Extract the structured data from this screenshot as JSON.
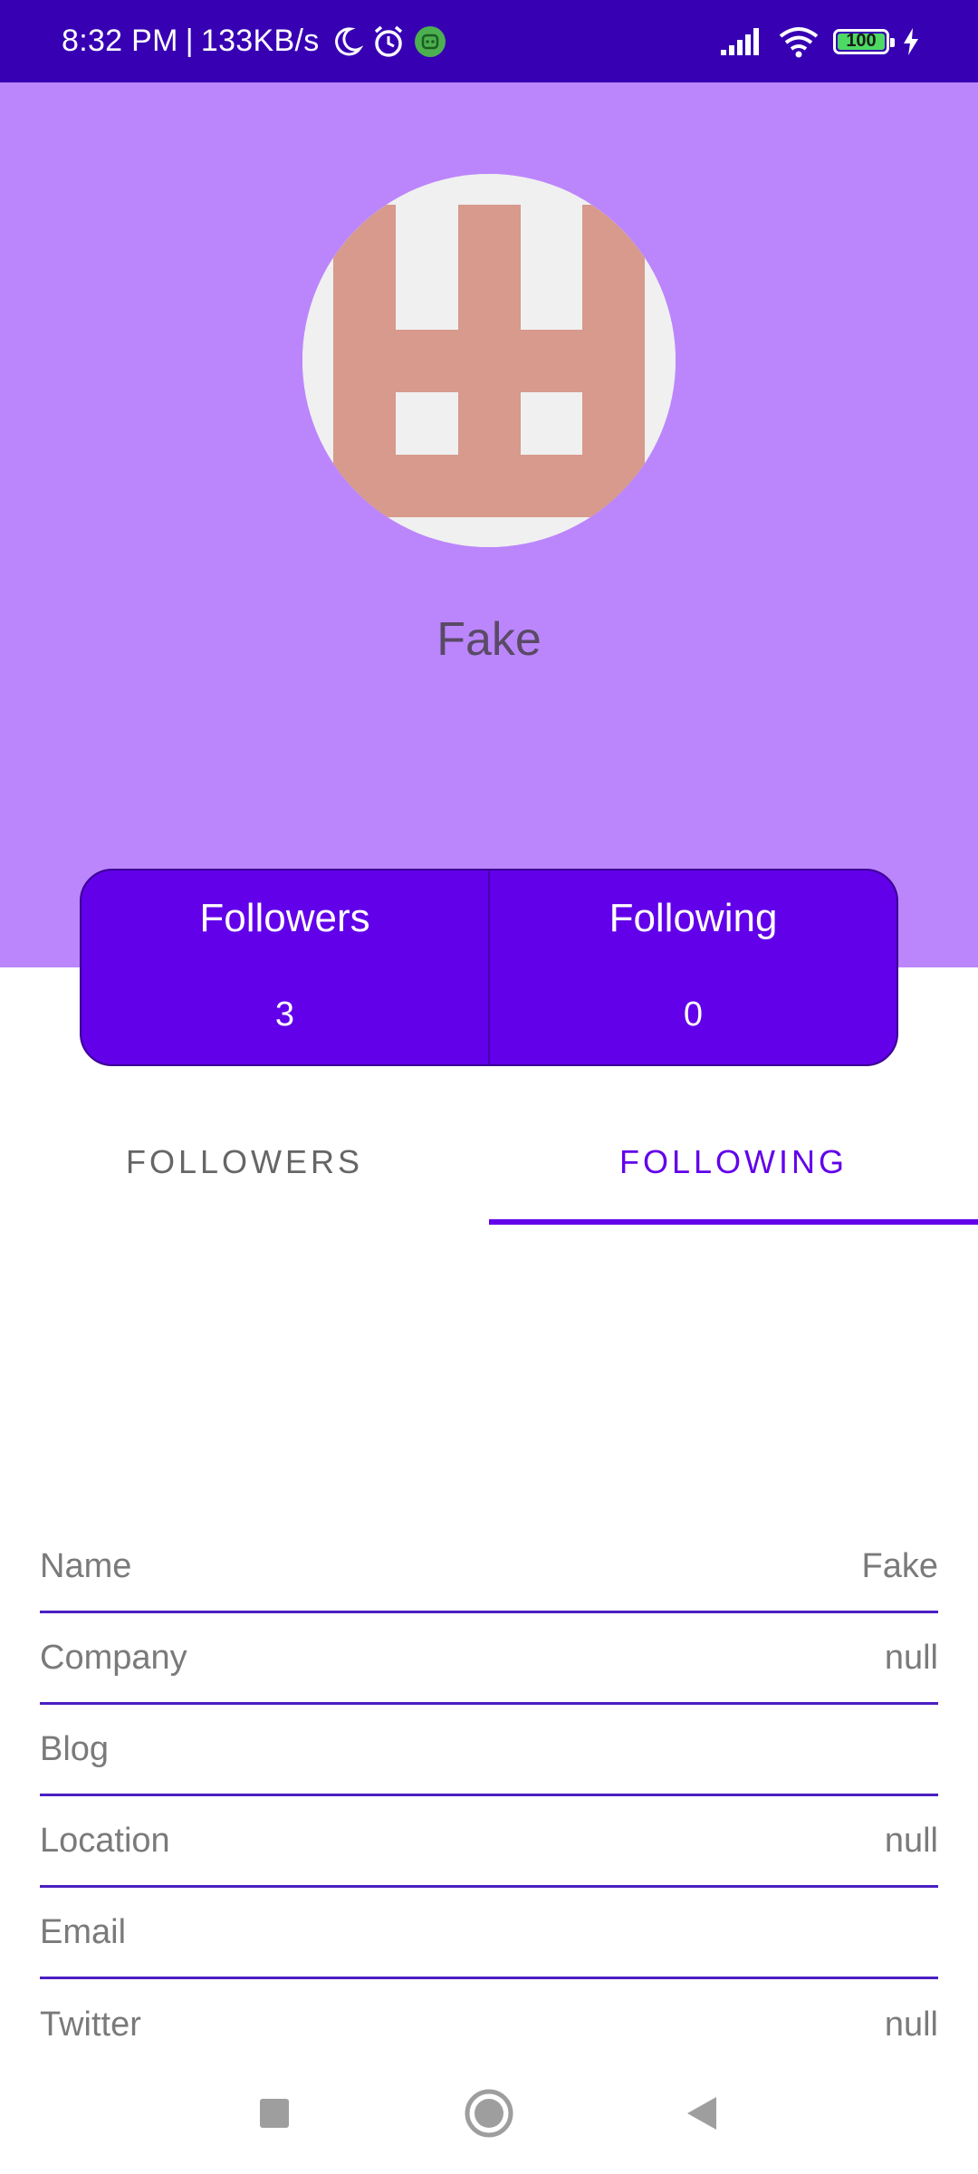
{
  "status_bar": {
    "time": "8:32 PM",
    "separator": "|",
    "speed": "133KB/s",
    "battery_level": "100",
    "icons": [
      "moon-icon",
      "alarm-icon",
      "app-notification-icon",
      "signal-icon",
      "wifi-icon",
      "battery-icon",
      "charging-icon"
    ]
  },
  "profile": {
    "name": "Fake",
    "avatar_colors": {
      "pattern": "#d79a8c",
      "background": "#f0f0f0"
    }
  },
  "stats": {
    "followers_label": "Followers",
    "followers_count": "3",
    "following_label": "Following",
    "following_count": "0"
  },
  "tabs": [
    {
      "label": "FOLLOWERS",
      "active": false
    },
    {
      "label": "FOLLOWING",
      "active": true
    }
  ],
  "details": [
    {
      "label": "Name",
      "value": "Fake"
    },
    {
      "label": "Company",
      "value": "null"
    },
    {
      "label": "Blog",
      "value": ""
    },
    {
      "label": "Location",
      "value": "null"
    },
    {
      "label": "Email",
      "value": ""
    },
    {
      "label": "Twitter",
      "value": "null"
    }
  ],
  "nav": {
    "icons": [
      "recents-square-icon",
      "home-circle-icon",
      "back-triangle-icon"
    ]
  },
  "colors": {
    "status_bar": "#3700b3",
    "header": "#bb86fc",
    "accent": "#6200ea"
  }
}
